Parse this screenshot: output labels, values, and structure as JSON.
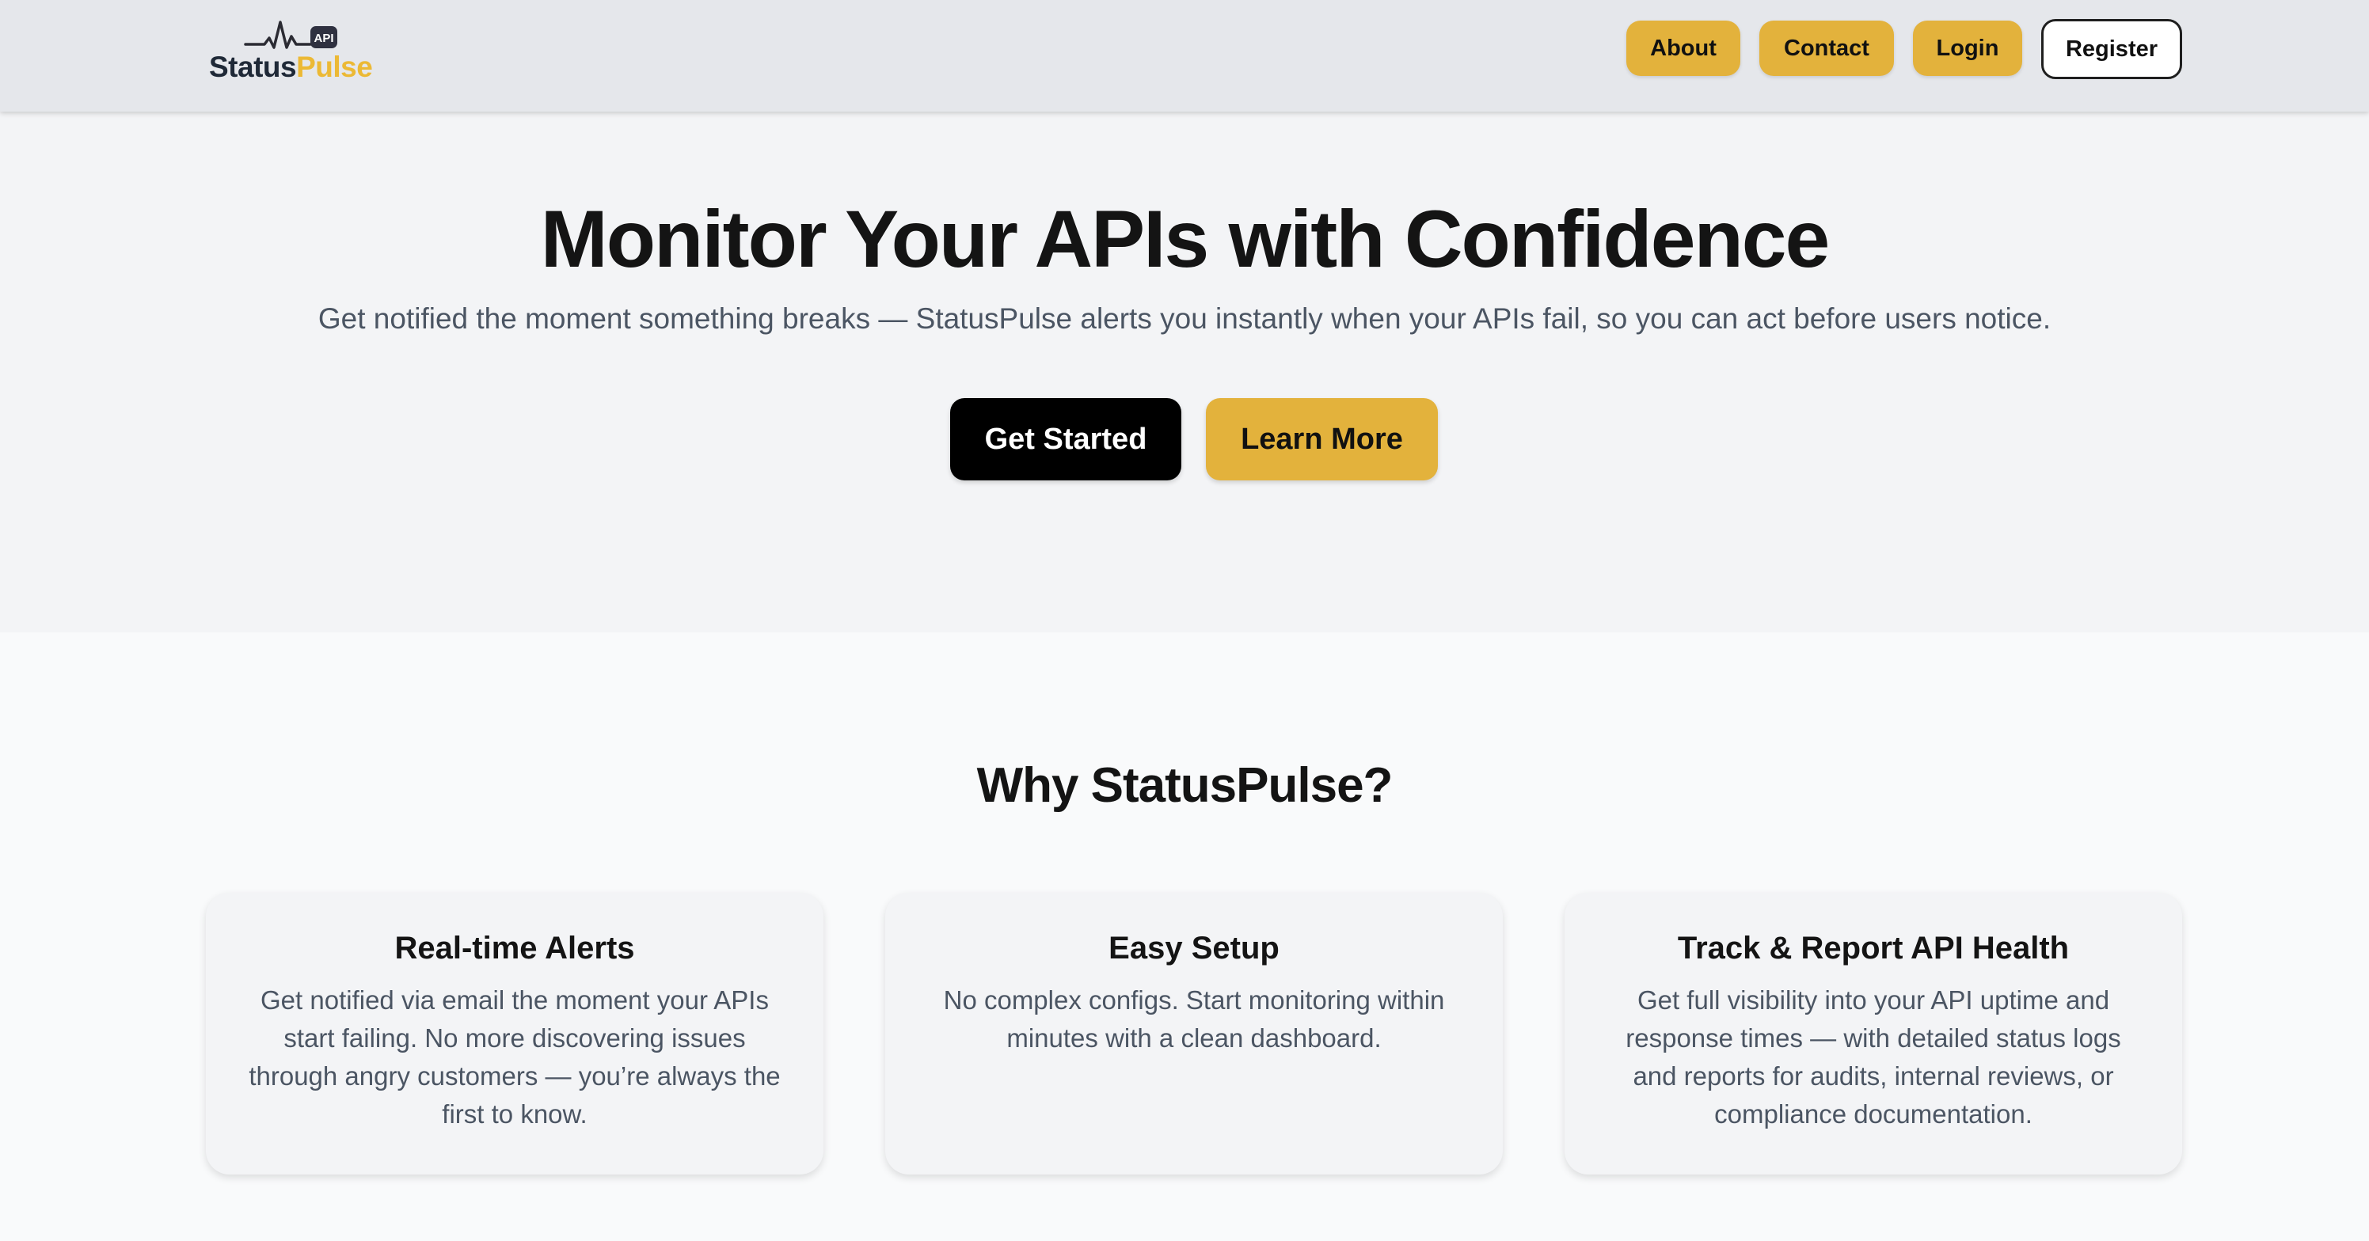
{
  "brand": {
    "name_part1": "Status",
    "name_part2": "Pulse",
    "badge": "API",
    "accent_color": "#e3b23c"
  },
  "nav": {
    "about": "About",
    "contact": "Contact",
    "login": "Login",
    "register": "Register"
  },
  "hero": {
    "title": "Monitor Your APIs with Confidence",
    "subtitle": "Get notified the moment something breaks — StatusPulse alerts you instantly when your APIs fail, so you can act before users notice.",
    "primary_cta": "Get Started",
    "secondary_cta": "Learn More"
  },
  "features": {
    "title": "Why StatusPulse?",
    "items": [
      {
        "title": "Real-time Alerts",
        "text": "Get notified via email the moment your APIs start failing. No more discovering issues through angry customers — you’re always the first to know."
      },
      {
        "title": "Easy Setup",
        "text": "No complex configs. Start monitoring within minutes with a clean dashboard."
      },
      {
        "title": "Track & Report API Health",
        "text": "Get full visibility into your API uptime and response times — with detailed status logs and reports for audits, internal reviews, or compliance documentation."
      }
    ]
  }
}
